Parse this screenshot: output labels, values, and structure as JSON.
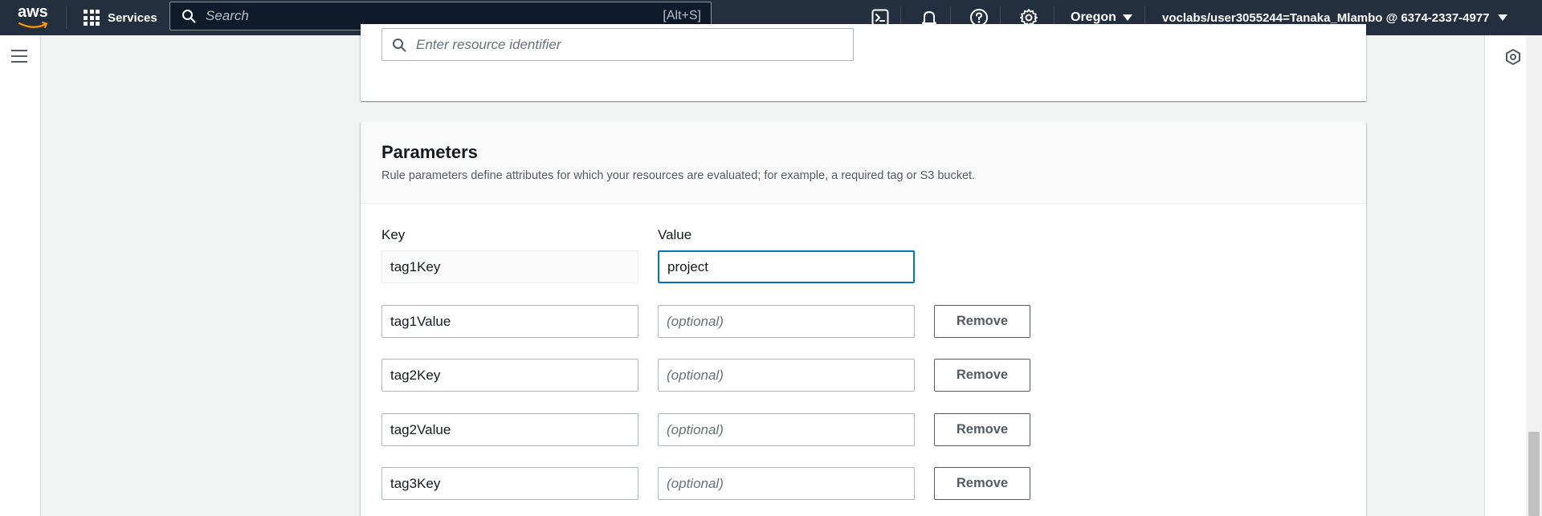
{
  "topnav": {
    "logo_text": "aws",
    "services_label": "Services",
    "search_placeholder": "Search",
    "search_shortcut": "[Alt+S]",
    "region_label": "Oregon",
    "account_label": "voclabs/user3055244=Tanaka_Mlambo @ 6374-2337-4977",
    "icons": [
      "cloudshell-icon",
      "bell-icon",
      "help-icon",
      "gear-icon"
    ]
  },
  "resource": {
    "placeholder": "Enter resource identifier"
  },
  "parameters": {
    "title": "Parameters",
    "description": "Rule parameters define attributes for which your resources are evaluated; for example, a required tag or S3 bucket.",
    "key_label": "Key",
    "value_label": "Value",
    "first_row": {
      "key": "tag1Key",
      "value": "project"
    },
    "rows": [
      {
        "key": "tag1Value",
        "value_placeholder": "(optional)",
        "remove_label": "Remove"
      },
      {
        "key": "tag2Key",
        "value_placeholder": "(optional)",
        "remove_label": "Remove"
      },
      {
        "key": "tag2Value",
        "value_placeholder": "(optional)",
        "remove_label": "Remove"
      },
      {
        "key": "tag3Key",
        "value_placeholder": "(optional)",
        "remove_label": "Remove"
      }
    ]
  },
  "colors": {
    "nav_bg": "#232f3e",
    "focus_border": "#0073bb",
    "page_bg": "#f2f3f3"
  }
}
